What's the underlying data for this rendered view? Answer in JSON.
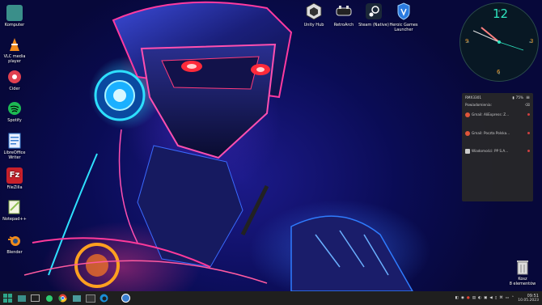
{
  "desktop": {
    "left_icons": [
      {
        "label": "Komputer",
        "icon": "folder-icon",
        "color": "#3a8f8a"
      },
      {
        "label": "VLC media player",
        "icon": "vlc-cone-icon",
        "color": "#f08a1c"
      },
      {
        "label": "Cider",
        "icon": "cider-icon",
        "color": "#e04050"
      },
      {
        "label": "Spotify",
        "icon": "spotify-icon",
        "color": "#1db954"
      },
      {
        "label": "LibreOffice Writer",
        "icon": "writer-icon",
        "color": "#3a7fd0"
      },
      {
        "label": "FileZilla",
        "icon": "filezilla-icon",
        "color": "#c8202a"
      },
      {
        "label": "Notepad++",
        "icon": "notepad-icon",
        "color": "#8fc050"
      },
      {
        "label": "Blender",
        "icon": "blender-icon",
        "color": "#f08a1c"
      }
    ],
    "top_icons": [
      {
        "label": "Unity Hub",
        "icon": "unity-icon"
      },
      {
        "label": "RetroArch",
        "icon": "retroarch-icon"
      },
      {
        "label": "Steam (Native)",
        "icon": "steam-icon"
      },
      {
        "label": "Heroic Games Launcher",
        "icon": "heroic-icon"
      }
    ],
    "trash": {
      "label": "Kosz",
      "sublabel": "8 elementów",
      "icon": "trash-icon"
    }
  },
  "clock": {
    "numbers": [
      "12",
      "3",
      "6",
      "9"
    ]
  },
  "notifications": {
    "device": "RMX3301",
    "battery": "75%",
    "section": "Powiadomienia:",
    "items": [
      {
        "text": "Gmail: AliExpress: Z..."
      },
      {
        "text": "Gmail: Poczta Polska..."
      },
      {
        "text": "Wiadomości: PP S.A..."
      }
    ]
  },
  "taskbar": {
    "time": "09:51",
    "date": "10.05.2023"
  },
  "colors": {
    "taskbar": "#1f1f1f",
    "accent": "#2ee6c0"
  }
}
